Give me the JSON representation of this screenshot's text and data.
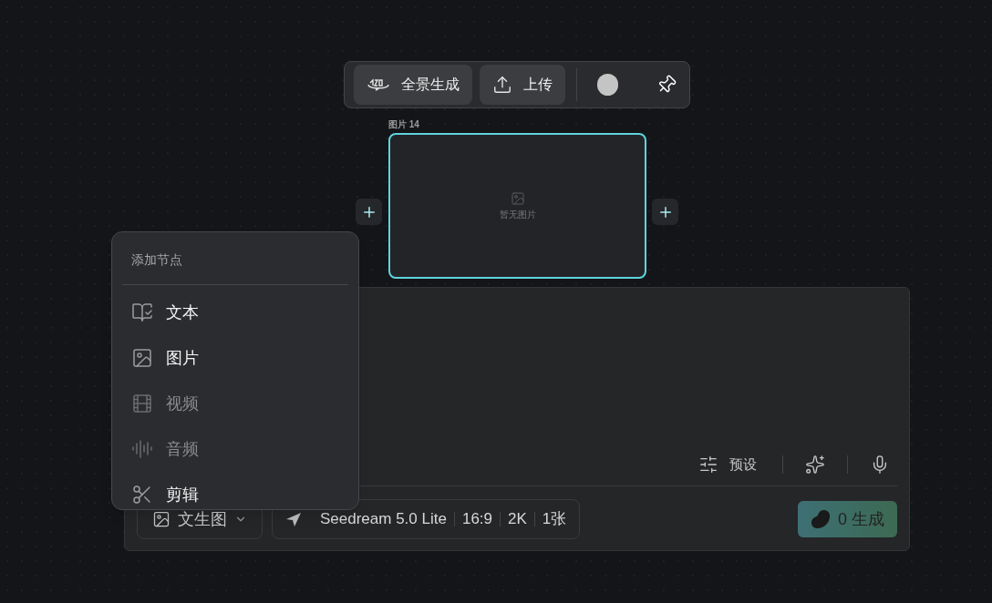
{
  "toolbar": {
    "buttons": [
      {
        "kind": "panorama",
        "label": "全景生成"
      },
      {
        "kind": "upload",
        "label": "上传"
      }
    ]
  },
  "node": {
    "label": "图片 14",
    "placeholder": "暂无图片",
    "selected": true
  },
  "menu": {
    "title": "添加节点",
    "items": [
      {
        "kind": "text",
        "label": "文本",
        "disabled": false
      },
      {
        "kind": "image",
        "label": "图片",
        "disabled": false
      },
      {
        "kind": "video",
        "label": "视频",
        "disabled": true
      },
      {
        "kind": "audio",
        "label": "音频",
        "disabled": true
      },
      {
        "kind": "edit",
        "label": "剪辑",
        "disabled": false
      }
    ]
  },
  "prompt": {
    "preset": "预设",
    "mode": "文生图",
    "model": "Seedream 5.0 Lite",
    "options": [
      "16:9",
      "2K",
      "1张"
    ],
    "generate": "0 生成"
  }
}
